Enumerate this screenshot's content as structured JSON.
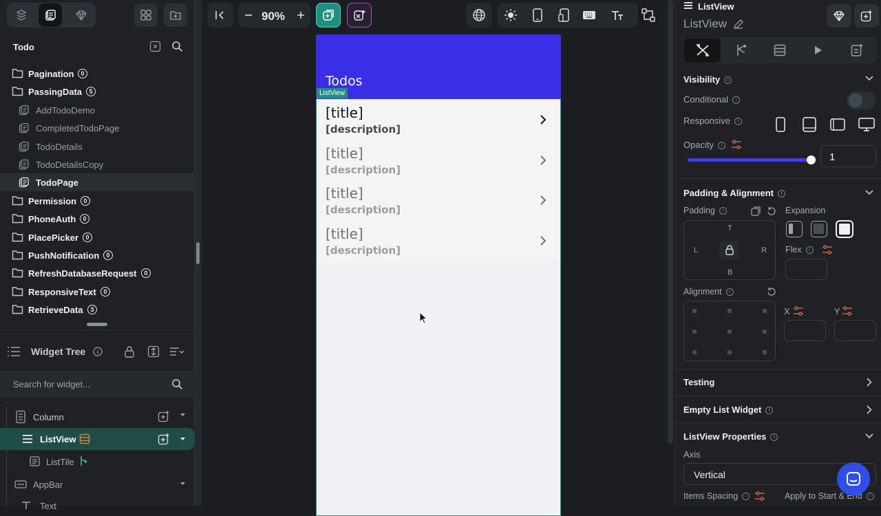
{
  "left_panel": {
    "project_title": "Todo",
    "tree": [
      {
        "type": "folder",
        "label": "Pagination",
        "count": "0"
      },
      {
        "type": "folder",
        "label": "PassingData",
        "count": "5"
      },
      {
        "type": "page",
        "label": "AddTodoDemo"
      },
      {
        "type": "page",
        "label": "CompletedTodoPage"
      },
      {
        "type": "page",
        "label": "TodoDetails"
      },
      {
        "type": "page",
        "label": "TodoDetailsCopy"
      },
      {
        "type": "page",
        "label": "TodoPage",
        "selected": true
      },
      {
        "type": "folder",
        "label": "Permission",
        "count": "0"
      },
      {
        "type": "folder",
        "label": "PhoneAuth",
        "count": "0"
      },
      {
        "type": "folder",
        "label": "PlacePicker",
        "count": "0"
      },
      {
        "type": "folder",
        "label": "PushNotification",
        "count": "0"
      },
      {
        "type": "folder",
        "label": "RefreshDatabaseRequest",
        "count": "0"
      },
      {
        "type": "folder",
        "label": "ResponsiveText",
        "count": "0"
      },
      {
        "type": "folder",
        "label": "RetrieveData",
        "count": "3"
      }
    ],
    "widget_tree": {
      "title": "Widget Tree",
      "search_placeholder": "Search for widget...",
      "nodes": [
        {
          "label": "Column"
        },
        {
          "label": "ListView",
          "selected": true
        },
        {
          "label": "ListTile"
        },
        {
          "label": "AppBar"
        },
        {
          "label": "Text"
        }
      ]
    }
  },
  "toolbar": {
    "zoom": "90%"
  },
  "phone": {
    "appbar_title": "Todos",
    "selection_badge": "ListView",
    "tiles": [
      {
        "title": "[title]",
        "description": "[description]"
      },
      {
        "title": "[title]",
        "description": "[description]"
      },
      {
        "title": "[title]",
        "description": "[description]"
      },
      {
        "title": "[title]",
        "description": "[description]"
      }
    ]
  },
  "right_panel": {
    "widget_type": "ListView",
    "widget_name": "ListView",
    "visibility": {
      "title": "Visibility",
      "conditional_label": "Conditional",
      "responsive_label": "Responsive",
      "opacity_label": "Opacity",
      "opacity_value": "1",
      "opacity_level": 1
    },
    "padding": {
      "title": "Padding & Alignment",
      "padding_label": "Padding",
      "expansion_label": "Expansion",
      "t": "T",
      "l": "L",
      "r": "R",
      "b": "B",
      "flex_label": "Flex",
      "alignment_label": "Alignment",
      "x_label": "X",
      "y_label": "Y"
    },
    "testing_title": "Testing",
    "empty_list_title": "Empty List Widget",
    "listview_props": {
      "title": "ListView Properties",
      "axis_label": "Axis",
      "axis_value": "Vertical",
      "items_spacing_label": "Items Spacing",
      "apply_label": "Apply to Start & End"
    }
  },
  "colors": {
    "accent_teal": "#1f8f7f",
    "appbar_purple": "#3a2ee8",
    "fab_blue": "#2f4ee8"
  }
}
